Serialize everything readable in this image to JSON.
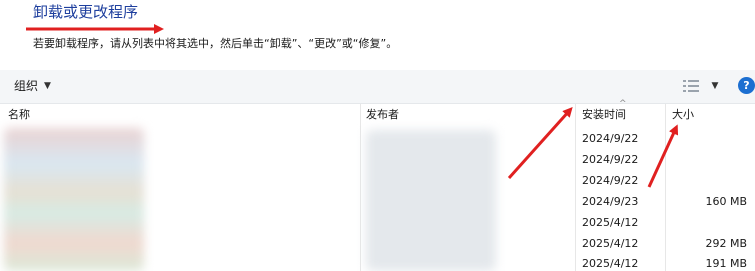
{
  "header": {
    "title": "卸载或更改程序",
    "subtitle": "若要卸载程序，请从列表中将其选中，然后单击“卸载”、“更改”或“修复”。"
  },
  "toolbar": {
    "organize_label": "组织",
    "organize_caret": "▼",
    "view_icon": "view-list-icon",
    "view_menu_caret": "▼",
    "help_label": "?"
  },
  "columns": {
    "name": "名称",
    "publisher": "发布者",
    "installed_on": "安装时间",
    "size": "大小",
    "sort_indicator": "^"
  },
  "rows": [
    {
      "date": "2024/9/22",
      "size": ""
    },
    {
      "date": "2024/9/22",
      "size": ""
    },
    {
      "date": "2024/9/22",
      "size": ""
    },
    {
      "date": "2024/9/23",
      "size": "160 MB"
    },
    {
      "date": "2025/4/12",
      "size": ""
    },
    {
      "date": "2025/4/12",
      "size": "292 MB"
    },
    {
      "date": "2025/4/12",
      "size": "191 MB"
    }
  ],
  "colors": {
    "title": "#1e3f9e",
    "annotation_arrow": "#e02020",
    "help_badge": "#1c6fd1"
  }
}
